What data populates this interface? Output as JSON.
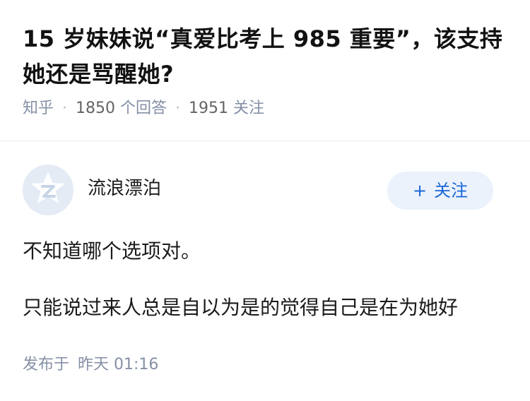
{
  "question": {
    "title": "15 岁妹妹说“真爱比考上 985 重要”，该支持她还是骂醒她?",
    "source": "知乎",
    "answers_count": "1850",
    "answers_label": "个回答",
    "followers_count": "1951",
    "followers_label": "关注"
  },
  "author": {
    "name": "流浪漂泊",
    "avatar_icon": "zhihu-default-avatar-icon",
    "follow_label": "关注",
    "follow_icon": "plus-icon"
  },
  "answer": {
    "paragraphs": [
      "不知道哪个选项对。",
      "只能说过来人总是自以为是的觉得自己是在为她好"
    ]
  },
  "publish": {
    "label": "发布于",
    "time": "昨天 01:16"
  },
  "colors": {
    "accent": "#1a66d6",
    "follow_bg": "#ebf2fc",
    "meta_text": "#8590a6",
    "avatar_bg": "#e4ebf5"
  }
}
